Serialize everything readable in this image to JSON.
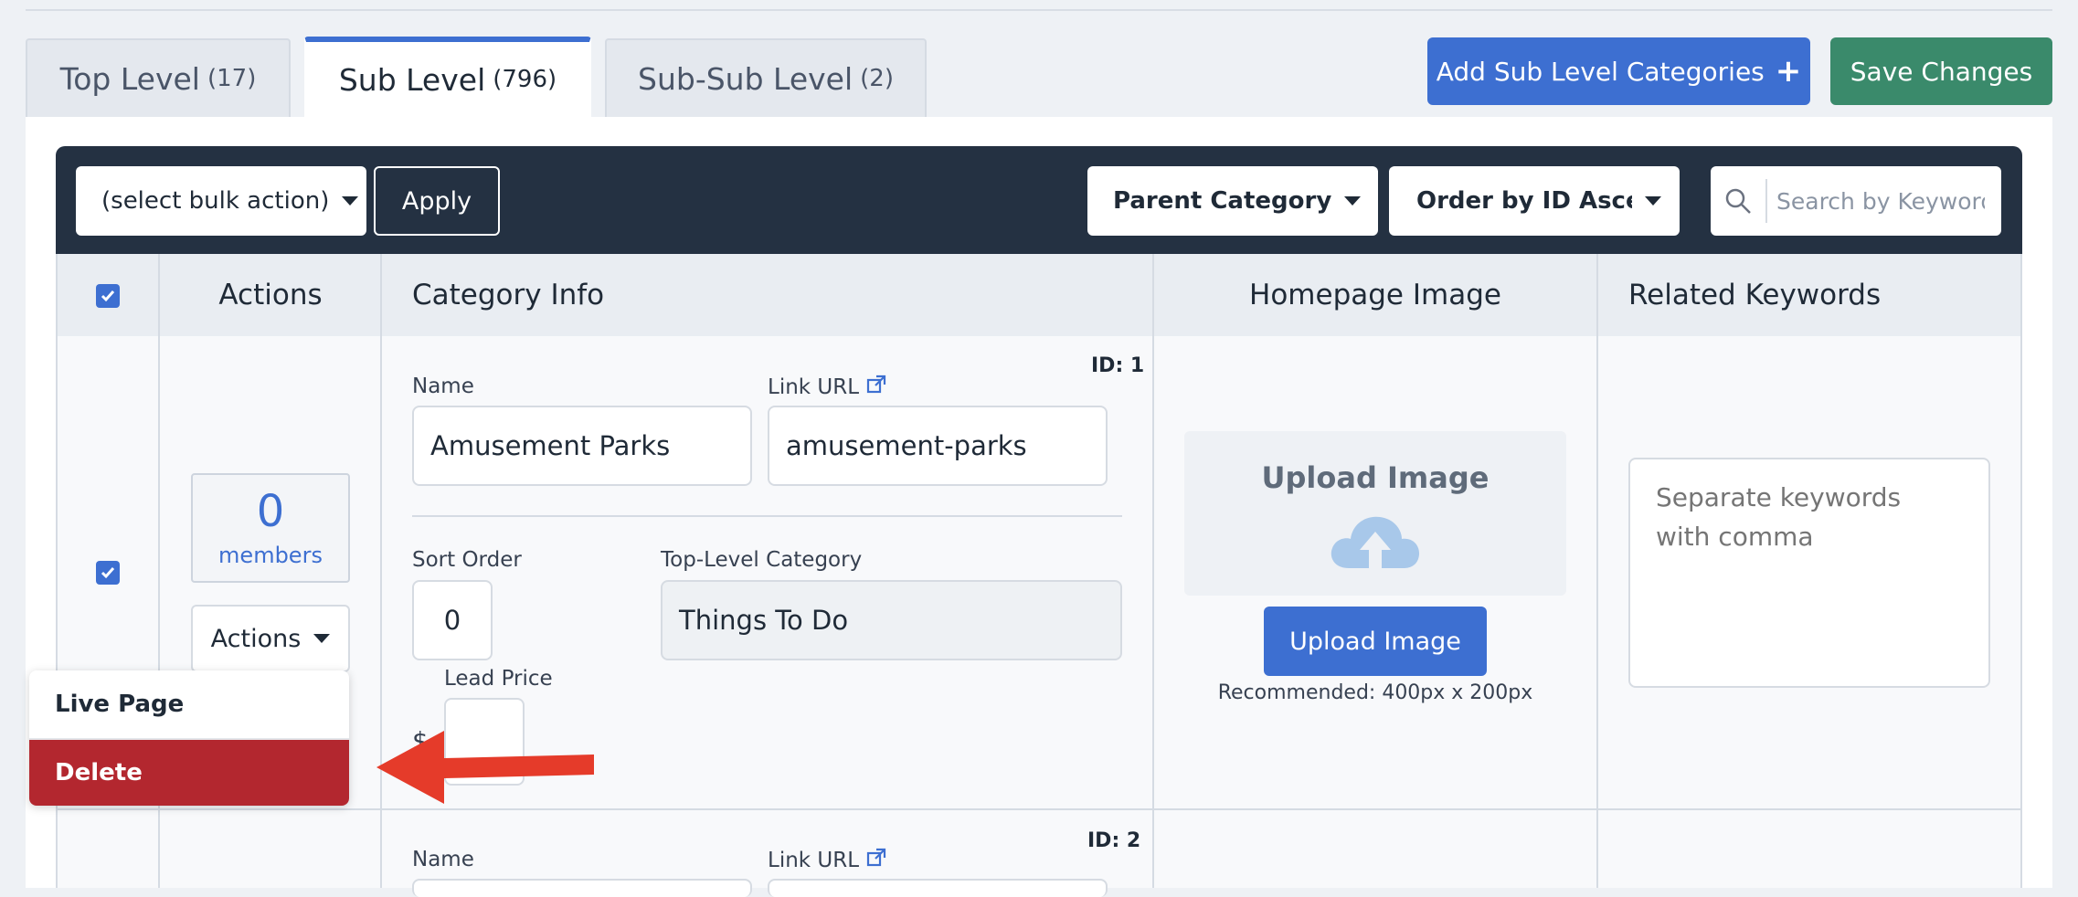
{
  "tabs": [
    {
      "label": "Top Level",
      "count": "(17)"
    },
    {
      "label": "Sub Level",
      "count": "(796)"
    },
    {
      "label": "Sub-Sub Level",
      "count": "(2)"
    }
  ],
  "buttons": {
    "add": "Add Sub Level Categories",
    "save": "Save Changes"
  },
  "toolbar": {
    "bulk": "(select bulk action)",
    "apply": "Apply",
    "parent": "Parent Category",
    "order": "Order by ID Ascending",
    "search_placeholder": "Search by Keyword"
  },
  "headers": {
    "actions": "Actions",
    "category_info": "Category Info",
    "homepage_image": "Homepage Image",
    "related_keywords": "Related Keywords"
  },
  "rows": [
    {
      "id": "ID: 1",
      "members_count": "0",
      "members_label": "members",
      "actions_label": "Actions",
      "name_label": "Name",
      "name": "Amusement Parks",
      "link_label": "Link URL",
      "link": "amusement-parks",
      "sort_label": "Sort Order",
      "sort": "0",
      "top_label": "Top-Level Category",
      "top": "Things To Do",
      "lead_label": "Lead Price",
      "currency": "$",
      "upload_title": "Upload Image",
      "upload_button": "Upload Image",
      "recommended": "Recommended: 400px x 200px",
      "keywords_placeholder": "Separate keywords with comma"
    },
    {
      "id": "ID: 2",
      "name_label": "Name",
      "link_label": "Link URL"
    }
  ],
  "menu": {
    "live": "Live Page",
    "delete": "Delete"
  },
  "colors": {
    "primary": "#3d6fd1",
    "success": "#3a8a6b",
    "dark": "#243142",
    "danger": "#b3272f",
    "arrow": "#e53b2a"
  }
}
